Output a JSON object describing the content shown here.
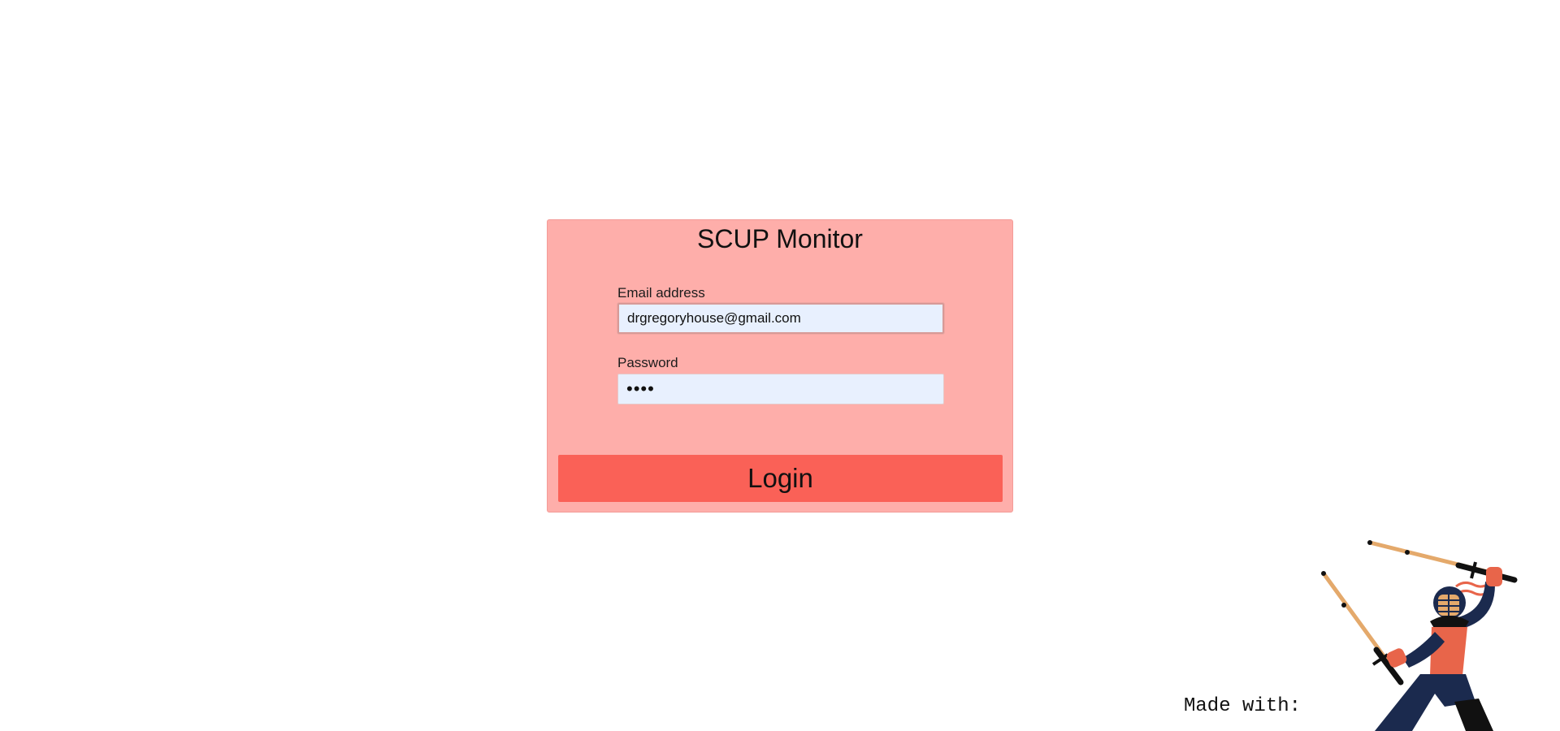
{
  "login": {
    "title": "SCUP Monitor",
    "email_label": "Email address",
    "email_value": "drgregoryhouse@gmail.com",
    "password_label": "Password",
    "password_value": "••••",
    "button_label": "Login"
  },
  "footer": {
    "made_with": "Made with:",
    "mascot_icon": "kendo-samurai-illustration"
  },
  "colors": {
    "card_bg": "#feaeaa",
    "button_bg": "#fa6157",
    "input_bg": "#e8f0fe"
  }
}
